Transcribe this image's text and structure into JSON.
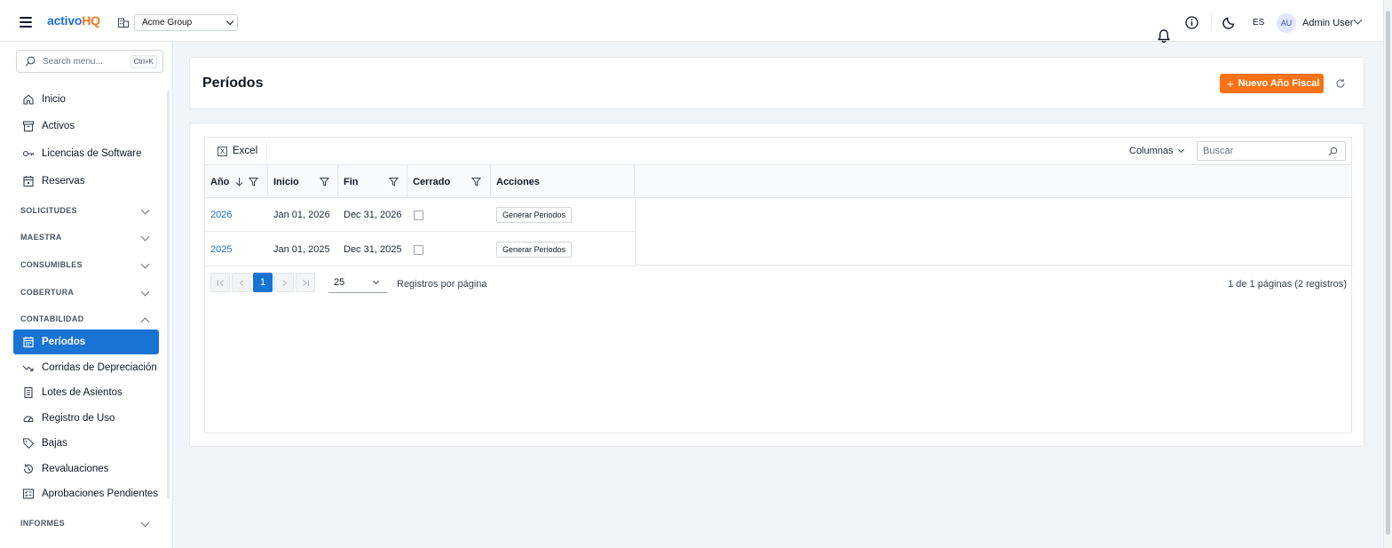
{
  "app": {
    "logo_part1": "activo",
    "logo_part2": "HQ",
    "company": "Acme Group",
    "lang": "ES",
    "user_initials": "AU",
    "user_name": "Admin User",
    "accent": "#1873d3",
    "brand_orange": "#f97316"
  },
  "sidebar": {
    "search_placeholder": "Search menu...",
    "search_shortcut": "Ctrl+K",
    "items": [
      {
        "label": "Inicio",
        "icon": "home-icon"
      },
      {
        "label": "Activos",
        "icon": "archive-icon"
      },
      {
        "label": "Licencias de Software",
        "icon": "key-icon"
      },
      {
        "label": "Reservas",
        "icon": "calendar-icon"
      }
    ],
    "sections": {
      "solicitudes": "SOLICITUDES",
      "maestra": "MAESTRA",
      "consumibles": "CONSUMIBLES",
      "cobertura": "COBERTURA",
      "contabilidad": "CONTABILIDAD",
      "informes": "INFORMES"
    },
    "contabilidad_items": [
      {
        "label": "Períodos",
        "icon": "calendar-grid-icon",
        "active": true
      },
      {
        "label": "Corridas de Depreciación",
        "icon": "trending-down-icon"
      },
      {
        "label": "Lotes de Asientos",
        "icon": "receipt-icon"
      },
      {
        "label": "Registro de Uso",
        "icon": "gauge-icon"
      },
      {
        "label": "Bajas",
        "icon": "tag-icon"
      },
      {
        "label": "Revaluaciones",
        "icon": "refresh-clock-icon"
      },
      {
        "label": "Aprobaciones Pendientes",
        "icon": "checklist-icon"
      }
    ]
  },
  "header": {
    "title": "Períodos",
    "new_button": "Nuevo Año Fiscal"
  },
  "grid": {
    "excel_label": "Excel",
    "columns_label": "Columnas",
    "search_placeholder": "Buscar",
    "columns": [
      "Año",
      "Inicio",
      "Fin",
      "Cerrado",
      "Acciones"
    ],
    "rows": [
      {
        "year": "2026",
        "start": "Jan 01, 2026",
        "end": "Dec 31, 2026",
        "closed": false,
        "action": "Generar Periodos"
      },
      {
        "year": "2025",
        "start": "Jan 01, 2025",
        "end": "Dec 31, 2025",
        "closed": false,
        "action": "Generar Periodos"
      }
    ],
    "pager": {
      "current_page": "1",
      "page_size": "25",
      "per_page_label": "Registros por página",
      "info": "1 de 1 páginas (2 registros)"
    }
  }
}
